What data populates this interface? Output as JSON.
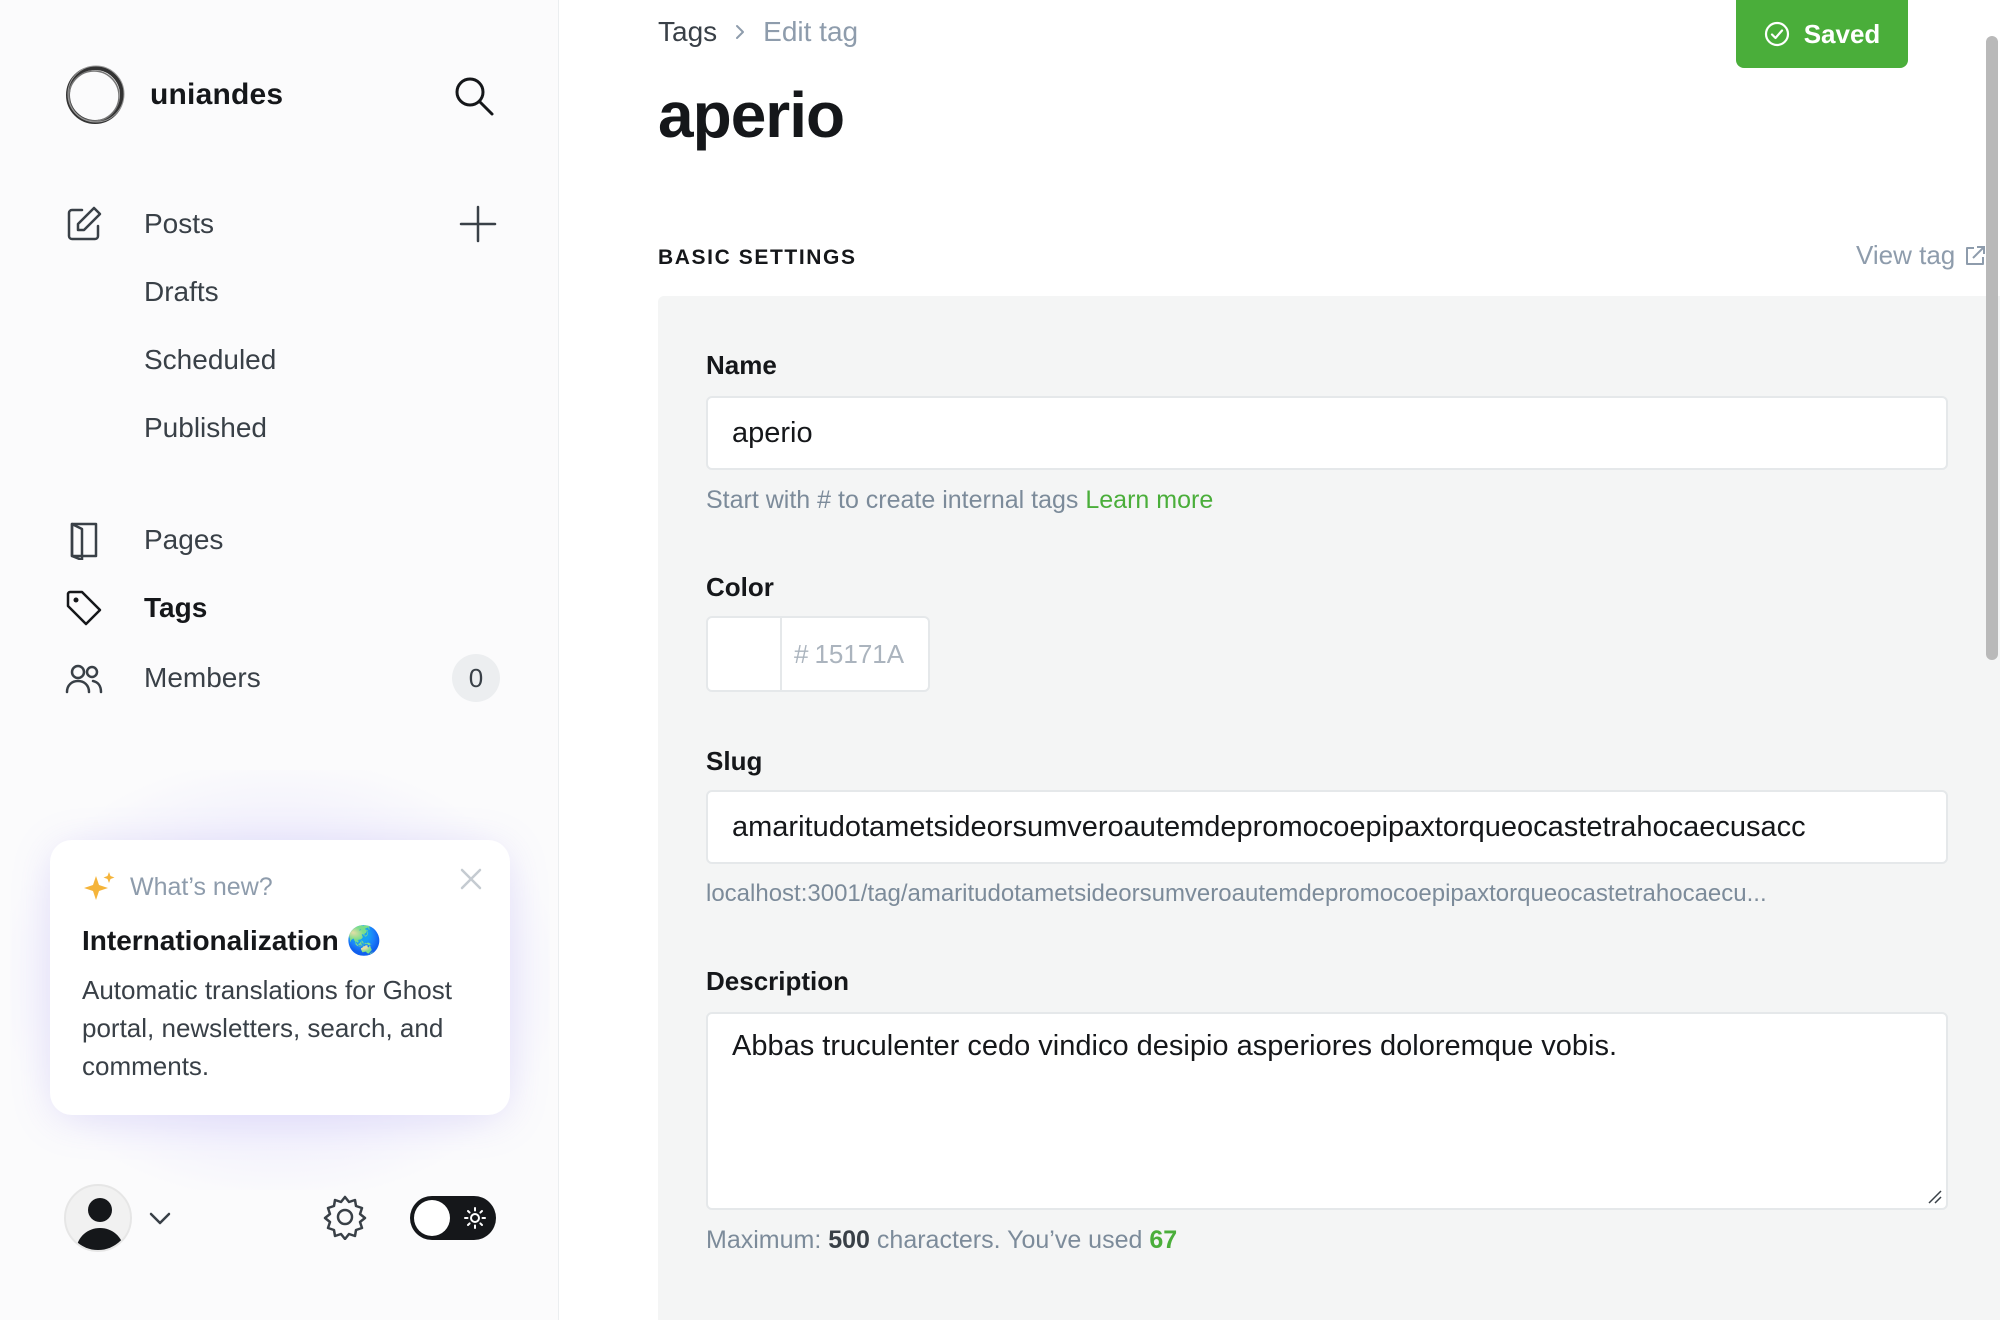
{
  "sidebar": {
    "site_name": "uniandes",
    "nav": {
      "posts": "Posts",
      "drafts": "Drafts",
      "scheduled": "Scheduled",
      "published": "Published",
      "pages": "Pages",
      "tags": "Tags",
      "members": "Members",
      "members_count": "0"
    },
    "whats_new": {
      "kicker": "What’s new?",
      "title": "Internationalization 🌏",
      "body": "Automatic translations for Ghost portal, newsletters, search, and comments."
    }
  },
  "header": {
    "breadcrumb_root": "Tags",
    "breadcrumb_current": "Edit tag",
    "title": "aperio",
    "saved_label": "Saved"
  },
  "basic_settings": {
    "section_title": "BASIC SETTINGS",
    "view_tag": "View tag",
    "name_label": "Name",
    "name_value": "aperio",
    "name_hint": "Start with # to create internal tags",
    "name_hint_link": "Learn more",
    "color_label": "Color",
    "color_hash": "#",
    "color_value": "15171A",
    "slug_label": "Slug",
    "slug_value": "amaritudotametsideorsumveroautemdepromocoepipaxtorqueocastetrahocaecusacc",
    "slug_url": "localhost:3001/tag/amaritudotametsideorsumveroautemdepromocoepipaxtorqueocastetrahocaecu...",
    "description_label": "Description",
    "description_value": "Abbas truculenter cedo vindico desipio asperiores doloremque vobis.",
    "counter_prefix": "Maximum:",
    "counter_max": "500",
    "counter_mid": "characters. You’ve used",
    "counter_used": "67"
  },
  "colors": {
    "accent_green": "#4aae3a",
    "text_dark": "#15171a",
    "muted": "#8e9cac"
  }
}
